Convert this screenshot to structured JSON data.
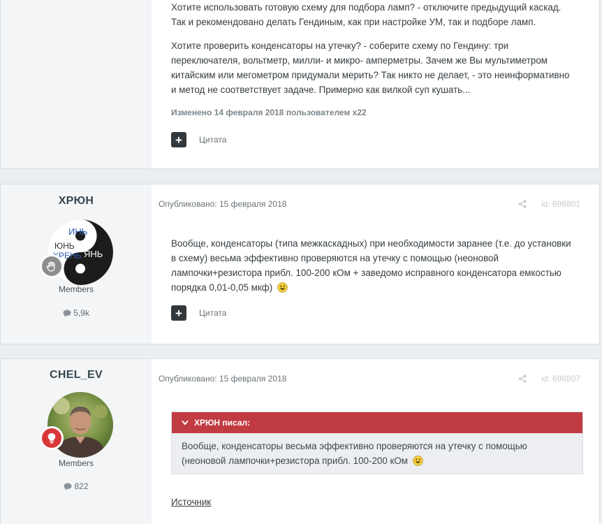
{
  "post1": {
    "paragraphs": [
      "Хотите использовать готовую схему для подбора ламп? - отключите предыдущий каскад. Так и рекомендовано делать Гендиным, как при настройке УМ, так и подборе ламп.",
      "Хотите проверить конденсаторы на утечку? - соберите схему по Гендину: три переключателя, вольтметр, милли- и микро- амперметры. Зачем же Вы мультиметром китайским или мегометром придумали мерить? Так никто не делает, - это неинформативно и метод не соответствует задаче. Примерно как вилкой суп кушать..."
    ],
    "edited_note": "Изменено 14 февраля 2018 пользователем x22",
    "quote_label": "Цитата"
  },
  "post2": {
    "author": "ХРЮН",
    "avatar_text": [
      "ИНЬ",
      "ЮНЬ",
      "ХРЕНЬ",
      "ЯНЬ"
    ],
    "rank_icon": "hand-icon",
    "group": "Members",
    "post_count": "5,9k",
    "published": "Опубликовано: 15 февраля 2018",
    "post_id": "id: 696801",
    "text": "Вообще, конденсаторы (типа межкаскадных) при необходимости заранее (т.е. до установки в схему) весьма эффективно проверяются на утечку с помощью (неоновой лампочки+резистора прибл. 100-200 кОм + заведомо исправного конденсатора емкостью порядка 0,01-0,05 мкф)",
    "quote_label": "Цитата"
  },
  "post3": {
    "author": "CHEL_EV",
    "rank_icon": "lightbulb-icon",
    "group": "Members",
    "post_count": "822",
    "published": "Опубликовано: 15 февраля 2018",
    "post_id": "id: 696807",
    "quote_author": "ХРЮН писал:",
    "quote_text": "Вообще, конденсаторы весьма эффективно проверяются на утечку с помощью (неоновой лампочки+резистора прибл. 100-200 кОм",
    "source_label": "Источник"
  },
  "colors": {
    "quote_header": "#c13b43",
    "rank_grey": "#8d8d8d",
    "rank_red": "#d9383a",
    "aside_bg": "#f3f5f7"
  }
}
